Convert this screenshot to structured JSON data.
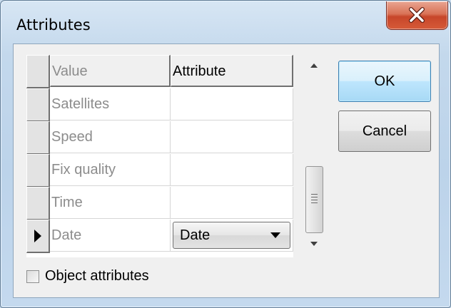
{
  "window": {
    "title": "Attributes"
  },
  "grid": {
    "columns": [
      "Value",
      "Attribute"
    ],
    "rows": [
      {
        "value": "Satellites",
        "attribute": ""
      },
      {
        "value": "Speed",
        "attribute": ""
      },
      {
        "value": "Fix quality",
        "attribute": ""
      },
      {
        "value": "Time",
        "attribute": ""
      },
      {
        "value": "Date",
        "attribute": "Date",
        "current": true
      }
    ],
    "current_row_icon": "right-triangle-pointer-icon"
  },
  "buttons": {
    "ok_label": "OK",
    "cancel_label": "Cancel"
  },
  "object_attributes": {
    "label": "Object attributes",
    "checked": false
  },
  "icons": {
    "close": "close-x-icon",
    "scroll_up": "scroll-up-arrow-icon",
    "scroll_down": "scroll-down-arrow-icon",
    "combo_caret": "chevron-down-icon"
  },
  "colors": {
    "close_button": "#c7462a",
    "default_button_border": "#3c7fb1",
    "grid_muted_text": "#8c8c8c"
  }
}
